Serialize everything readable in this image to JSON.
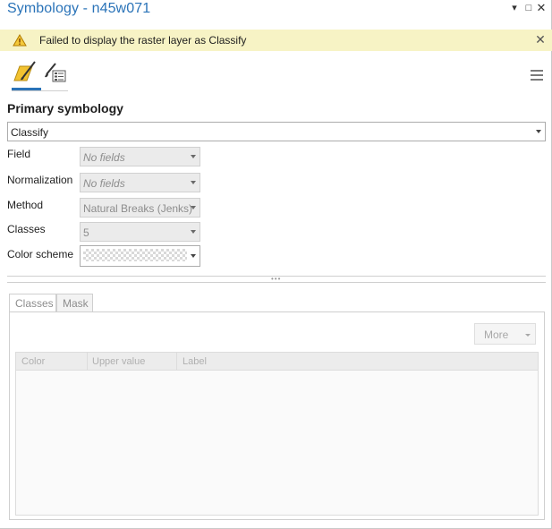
{
  "window": {
    "title": "Symbology - n45w071",
    "menu_glyph": "▾",
    "maximize_glyph": "□",
    "close_glyph": "✕"
  },
  "banner": {
    "message": "Failed to display the raster layer as Classify",
    "icon": "warning-icon",
    "close_glyph": "✕",
    "background": "#f7f3c5"
  },
  "tabs": {
    "icons": [
      "primary-symbology-brush-icon",
      "vary-symbology-icon"
    ],
    "active_index": 0,
    "accent": "#2a73b8"
  },
  "primary": {
    "heading": "Primary symbology",
    "selected": "Classify"
  },
  "fields": {
    "field_label": "Field",
    "field_value": "No fields",
    "normalization_label": "Normalization",
    "normalization_value": "No fields",
    "method_label": "Method",
    "method_value": "Natural Breaks (Jenks)",
    "classes_label": "Classes",
    "classes_value": "5",
    "color_scheme_label": "Color scheme"
  },
  "lower_tabs": [
    {
      "label": "Classes",
      "active": true
    },
    {
      "label": "Mask",
      "active": false
    }
  ],
  "classes_panel": {
    "more_button": "More",
    "columns": [
      "Color",
      "Upper value",
      "Label"
    ],
    "rows": []
  }
}
